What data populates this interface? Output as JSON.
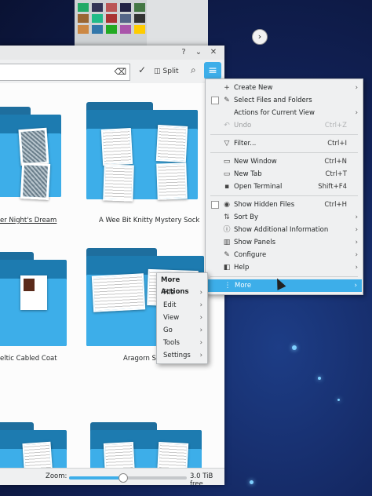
{
  "window": {
    "help_glyph": "?",
    "minimize_glyph": "⌄",
    "close_glyph": "✕",
    "toolbar": {
      "split_label": "Split",
      "clear_glyph": "⌫",
      "check_glyph": "✓",
      "search_glyph": "⌕",
      "menu_glyph": "≡"
    },
    "files": [
      {
        "name": "er Night's Dream",
        "underlined": true
      },
      {
        "name": "A Wee Bit Knitty Mystery Sock",
        "underlined": false
      },
      {
        "name": "eltic Cabled Coat",
        "underlined": false
      },
      {
        "name": "Aragorn So",
        "underlined": false
      }
    ],
    "status": {
      "zoom_label": "Zoom:",
      "zoom_level": 0.45,
      "free_space": "3.0 TiB free"
    }
  },
  "main_menu": {
    "items": [
      {
        "label": "Create New",
        "icon": "plus-icon",
        "glyph": "+",
        "shortcut": "",
        "submenu": true
      },
      {
        "label": "Select Files and Folders",
        "icon": "select-icon",
        "glyph": "✎",
        "shortcut": "",
        "checkbox": true
      },
      {
        "label": "Actions for Current View",
        "icon": "",
        "glyph": "",
        "shortcut": "",
        "submenu": true
      },
      {
        "label": "Undo",
        "icon": "undo-icon",
        "glyph": "↶",
        "shortcut": "Ctrl+Z",
        "disabled": true
      },
      {
        "label": "Filter...",
        "icon": "filter-icon",
        "glyph": "▽",
        "shortcut": "Ctrl+I"
      },
      {
        "label": "New Window",
        "icon": "new-window-icon",
        "glyph": "▭",
        "shortcut": "Ctrl+N"
      },
      {
        "label": "New Tab",
        "icon": "new-tab-icon",
        "glyph": "▭",
        "shortcut": "Ctrl+T"
      },
      {
        "label": "Open Terminal",
        "icon": "terminal-icon",
        "glyph": "▪",
        "shortcut": "Shift+F4"
      },
      {
        "label": "Show Hidden Files",
        "icon": "eye-icon",
        "glyph": "◉",
        "shortcut": "Ctrl+H",
        "checkbox": true
      },
      {
        "label": "Sort By",
        "icon": "sort-icon",
        "glyph": "⇅",
        "shortcut": "",
        "submenu": true
      },
      {
        "label": "Show Additional Information",
        "icon": "info-icon",
        "glyph": "ⓘ",
        "shortcut": "",
        "submenu": true
      },
      {
        "label": "Show Panels",
        "icon": "panels-icon",
        "glyph": "▥",
        "shortcut": "",
        "submenu": true
      },
      {
        "label": "Configure",
        "icon": "configure-icon",
        "glyph": "✎",
        "shortcut": "",
        "submenu": true
      },
      {
        "label": "Help",
        "icon": "help-icon",
        "glyph": "◧",
        "shortcut": "",
        "submenu": true
      },
      {
        "label": "More",
        "icon": "more-icon",
        "glyph": "⋮",
        "shortcut": "",
        "submenu": true,
        "active": true
      }
    ],
    "submenu_arrow": "›"
  },
  "more_actions": {
    "title": "More Actions",
    "items": [
      "File",
      "Edit",
      "View",
      "Go",
      "Tools",
      "Settings"
    ]
  },
  "colors": {
    "accent": "#3daee9",
    "folder_dark": "#1d7bb0",
    "desktop_bg": "#12235a"
  }
}
